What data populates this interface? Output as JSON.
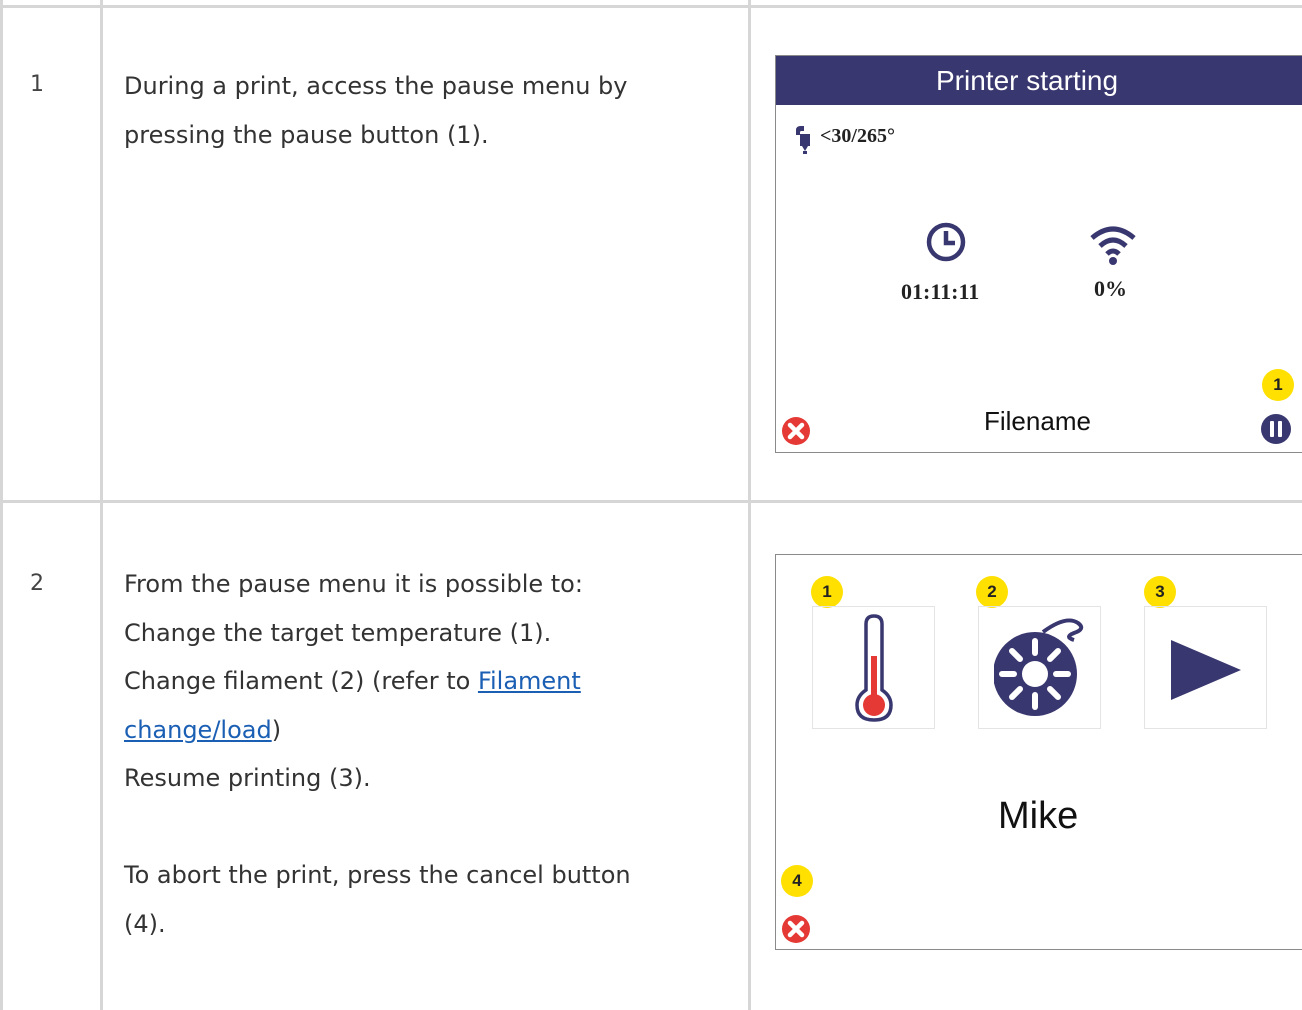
{
  "rows": [
    {
      "number": "1",
      "lines": [
        "During a print, access the pause menu by",
        "pressing the pause button (1)."
      ],
      "screen": {
        "title": "Printer starting",
        "temperature": "<30/265°",
        "time": "01:11:11",
        "progress": "0%",
        "filename": "Filename",
        "badge": "1",
        "icons": [
          "nozzle-icon",
          "clock-icon",
          "wifi-icon",
          "cancel-icon",
          "pause-icon"
        ]
      }
    },
    {
      "number": "2",
      "lines": [
        "From the pause menu it is possible to:",
        "Change the target temperature (1).",
        "Change filament (2) (refer to ",
        "Resume printing (3).",
        "To abort the print, press the cancel button",
        "(4)."
      ],
      "link": {
        "part1": "Filament",
        "part2": "change/load",
        "after": ")"
      },
      "screen": {
        "badges": [
          "1",
          "2",
          "3",
          "4"
        ],
        "name": "Mike",
        "icons": [
          "thermometer-icon",
          "filament-spool-icon",
          "play-icon",
          "cancel-icon"
        ]
      }
    }
  ],
  "colors": {
    "title_bar": "#39376f",
    "badge": "#ffe000",
    "cancel": "#e53935",
    "icon": "#39376f",
    "link": "#1a5fb4",
    "grid": "#d6d6d6"
  }
}
